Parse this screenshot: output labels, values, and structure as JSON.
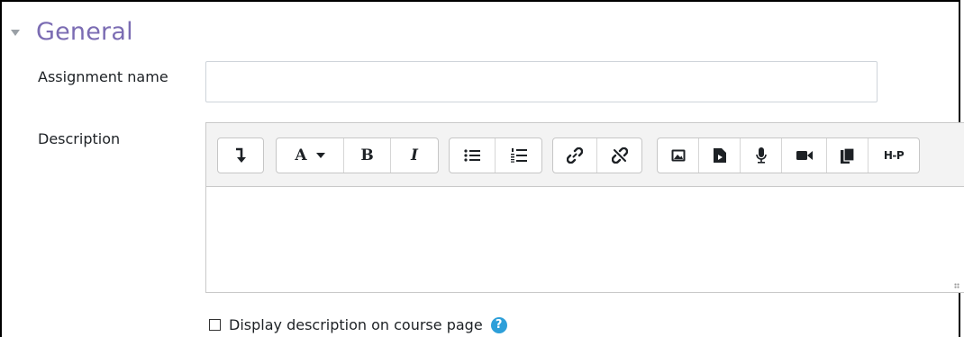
{
  "section": {
    "title": "General"
  },
  "fields": {
    "assignment_name": {
      "label": "Assignment name",
      "value": "",
      "placeholder": ""
    },
    "description": {
      "label": "Description",
      "value": ""
    }
  },
  "toolbar": {
    "format_letter": "A",
    "bold": "B",
    "italic": "I",
    "h5p": "H-P",
    "icons": [
      "collapse-toolbar-icon",
      "font-style-icon",
      "bold-icon",
      "italic-icon",
      "unordered-list-icon",
      "ordered-list-icon",
      "link-icon",
      "unlink-icon",
      "image-icon",
      "media-icon",
      "microphone-icon",
      "video-icon",
      "manage-files-icon",
      "h5p-icon"
    ]
  },
  "display_description": {
    "label": "Display description on course page",
    "checked": false,
    "help": "?"
  },
  "colors": {
    "section_title": "#7b6cb3",
    "help_icon": "#2d9fd9",
    "toolbar_bg": "#f3f3f3"
  }
}
